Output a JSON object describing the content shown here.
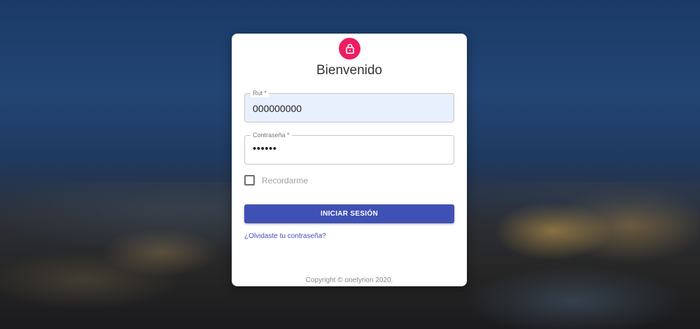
{
  "login": {
    "title": "Bienvenido",
    "lock_icon": "lock-icon",
    "rut": {
      "label": "Rut *",
      "value": "000000000"
    },
    "password": {
      "label": "Contraseña *",
      "value": "••••••"
    },
    "remember_label": "Recordarme",
    "submit_label": "INICIAR SESIÓN",
    "forgot_label": "¿Olvidaste tu contraseña?",
    "copyright": "Copyright © onetyrion 2020."
  },
  "colors": {
    "accent": "#3f51b5",
    "avatar": "#ec1e62",
    "autofill_bg": "#e8f0fe"
  }
}
